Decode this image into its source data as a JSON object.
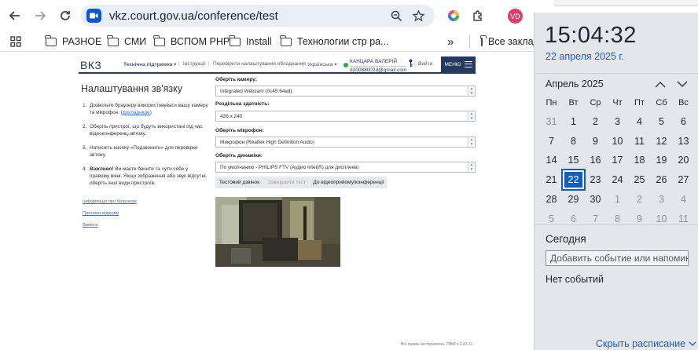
{
  "browser": {
    "url": "vkz.court.gov.ua/conference/test",
    "avatar_initials": "VD",
    "bookmarks": [
      {
        "label": "РАЗНОЕ"
      },
      {
        "label": "СМИ"
      },
      {
        "label": "ВСПОМ PHP"
      },
      {
        "label": "Install"
      },
      {
        "label": "Технологии стр ра..."
      }
    ],
    "overflow_chevron": "»",
    "all_bookmarks": "Все заклад"
  },
  "site": {
    "logo": "ВКЗ",
    "nav": {
      "support": "Технічна підтримка ▾",
      "instructions": "Інструкції",
      "check_settings": "Перевірити налаштування обладнання",
      "language": "Українська ▾",
      "user_name": "КАНЦАРА ВАЛЕРІЙ",
      "user_email": "d20088002d@gmail.com",
      "logout": "Вийти",
      "menu": "МЕНЮ"
    },
    "page_title": "Налаштування зв'язку",
    "steps": [
      {
        "num": "1.",
        "text": "Дозвольте браузеру використовувати вашу камеру та мікрофон. (",
        "link": "докладніше",
        "tail": ")"
      },
      {
        "num": "2.",
        "text": "Оберіть пристрої, що будуть використані під час відеоконференц-зв'язку."
      },
      {
        "num": "3.",
        "text": "Натисніть кнопку «Подзвонити» для перевірки зв'язку."
      },
      {
        "num": "4.",
        "bold": "Важливо!",
        "text": " Ви маєте бачити та чути себе у правому вікні. Якщо зображення або звук відсутні, оберіть інші види пристроїв."
      }
    ],
    "side_links": [
      "Інформація про браузери",
      "Причини відмови",
      "Вимоги"
    ],
    "form": {
      "camera_label": "Оберіть камеру:",
      "camera_value": "Integrated Webcam (0c45:64ad)",
      "resolution_label": "Роздільна здатність:",
      "resolution_value": "426 x 240",
      "mic_label": "Оберіть мікрофон:",
      "mic_value": "Микрофон (Realtek High Definition Audio)",
      "speaker_label": "Оберіть динаміки:",
      "speaker_value": "По умолчанию - PHILIPS FTV (Аудио Intel(R) для дисплеев)",
      "btn_test_call": "Тестовий дзвінок",
      "btn_end_test": "Завершити тест",
      "btn_to_conference": "До відеоприйому/конференції"
    },
    "footer": "Всі права застережено. ПВМ v.2.41.11"
  },
  "calendar": {
    "time": "15:04:32",
    "date": "22 апреля 2025 г.",
    "month": "Апрель 2025",
    "weekdays": [
      "Пн",
      "Вт",
      "Ср",
      "Чт",
      "Пт",
      "Сб",
      "Вс"
    ],
    "days": [
      "31",
      "1",
      "2",
      "3",
      "4",
      "5",
      "6",
      "7",
      "8",
      "9",
      "10",
      "11",
      "12",
      "13",
      "14",
      "15",
      "16",
      "17",
      "18",
      "19",
      "20",
      "21",
      "22",
      "23",
      "24",
      "25",
      "26",
      "27",
      "28",
      "29",
      "30",
      "1",
      "2",
      "3",
      "4",
      "5",
      "6",
      "7",
      "8",
      "9",
      "10",
      "11"
    ],
    "out_of_month": [
      0,
      31,
      32,
      33,
      34,
      35,
      36,
      37,
      38,
      39,
      40,
      41
    ],
    "today_index": 22,
    "today_label": "Сегодня",
    "add_event_placeholder": "Добавить событие или напомина",
    "no_events": "Нет событий",
    "hide_schedule": "Скрыть расписание"
  },
  "colors": {
    "accent": "#0b57d0",
    "site_navy": "#233a5e",
    "calendar_today": "#0f5fc2",
    "online": "#2eaa47"
  }
}
